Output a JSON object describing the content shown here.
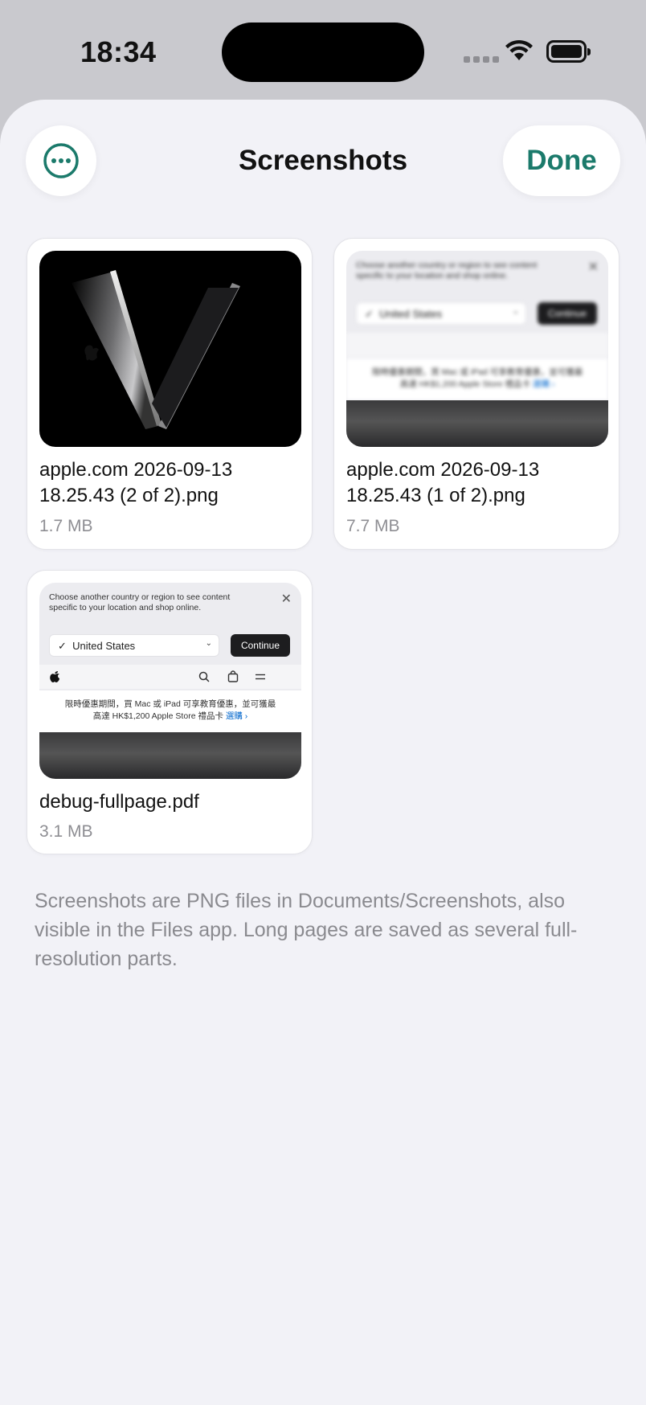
{
  "status_bar": {
    "time": "18:34",
    "icons": [
      "cellular-signal-icon",
      "wifi-icon",
      "battery-icon"
    ]
  },
  "header": {
    "more_icon": "ellipsis-circle-icon",
    "title": "Screenshots",
    "done_label": "Done"
  },
  "colors": {
    "accent": "#1b7a6b",
    "sheet_background": "#f2f2f7",
    "secondary_text": "#8e8e93"
  },
  "files": [
    {
      "name": "apple.com 2026-09-13 18.25.43 (2 of 2).png",
      "size": "1.7 MB",
      "thumbnail": "laptop-image"
    },
    {
      "name": "apple.com 2026-09-13 18.25.43 (1 of 2).png",
      "size": "7.7 MB",
      "thumbnail": "web-page-image"
    },
    {
      "name": "debug-fullpage.pdf",
      "size": "3.1 MB",
      "thumbnail": "web-page-image"
    }
  ],
  "thumbnail_page": {
    "message": "Choose another country or region to see content specific to your location and shop online.",
    "country": "United States",
    "continue_label": "Continue",
    "promo_line1": "限時優惠期間，買 Mac 或 iPad 可享教育優惠，並可獲最",
    "promo_line2": "高達 HK$1,200 Apple Store 禮品卡",
    "promo_link": "選購 ›"
  },
  "footer_note": "Screenshots are PNG files in Documents/Screenshots, also visible in the Files app. Long pages are saved as several full-resolution parts."
}
